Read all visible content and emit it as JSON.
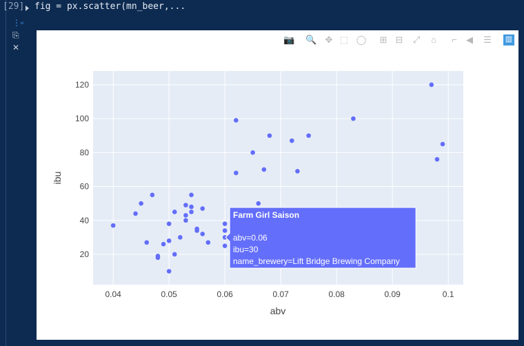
{
  "cell": {
    "execution_count": "[29]",
    "code": "fig = px.scatter(mn_beer,..."
  },
  "toolbar": [
    {
      "name": "camera-icon",
      "glyph": "📷"
    },
    {
      "name": "zoom-icon",
      "glyph": "🔍"
    },
    {
      "name": "pan-icon",
      "glyph": "✥"
    },
    {
      "name": "box-select-icon",
      "glyph": "⬚"
    },
    {
      "name": "lasso-icon",
      "glyph": "◯"
    },
    {
      "name": "zoom-in-icon",
      "glyph": "⊞"
    },
    {
      "name": "zoom-out-icon",
      "glyph": "⊟"
    },
    {
      "name": "autoscale-icon",
      "glyph": "⤢"
    },
    {
      "name": "reset-axes-icon",
      "glyph": "⌂"
    },
    {
      "name": "spike-lines-icon",
      "glyph": "⌐"
    },
    {
      "name": "hover-closest-icon",
      "glyph": "◀"
    },
    {
      "name": "hover-compare-icon",
      "glyph": "☰"
    },
    {
      "name": "plotly-logo-icon",
      "glyph": "▥"
    }
  ],
  "colors": {
    "marker": "#636efa",
    "plot_bg": "#e5ecf6",
    "grid": "#ffffff"
  },
  "chart_data": {
    "type": "scatter",
    "xlabel": "abv",
    "ylabel": "ibu",
    "xlim": [
      0.0364,
      0.1027
    ],
    "ylim": [
      2.1,
      128.1
    ],
    "xticks": [
      0.04,
      0.05,
      0.06,
      0.07,
      0.08,
      0.09,
      0.1
    ],
    "xtick_labels": [
      "0.04",
      "0.05",
      "0.06",
      "0.07",
      "0.08",
      "0.09",
      "0.1"
    ],
    "yticks": [
      20,
      40,
      60,
      80,
      100,
      120
    ],
    "ytick_labels": [
      "20",
      "40",
      "60",
      "80",
      "100",
      "120"
    ],
    "points": [
      [
        0.04,
        37
      ],
      [
        0.044,
        44
      ],
      [
        0.045,
        50
      ],
      [
        0.047,
        55
      ],
      [
        0.046,
        27
      ],
      [
        0.048,
        19
      ],
      [
        0.048,
        18
      ],
      [
        0.049,
        26
      ],
      [
        0.05,
        38
      ],
      [
        0.05,
        10
      ],
      [
        0.05,
        28
      ],
      [
        0.051,
        45
      ],
      [
        0.051,
        20
      ],
      [
        0.052,
        30
      ],
      [
        0.053,
        49
      ],
      [
        0.053,
        43
      ],
      [
        0.053,
        40
      ],
      [
        0.054,
        55
      ],
      [
        0.054,
        48
      ],
      [
        0.054,
        45
      ],
      [
        0.055,
        35
      ],
      [
        0.055,
        34
      ],
      [
        0.056,
        47
      ],
      [
        0.056,
        32
      ],
      [
        0.057,
        27
      ],
      [
        0.06,
        38
      ],
      [
        0.06,
        34
      ],
      [
        0.06,
        30
      ],
      [
        0.06,
        25
      ],
      [
        0.062,
        99
      ],
      [
        0.062,
        68
      ],
      [
        0.065,
        80
      ],
      [
        0.066,
        50
      ],
      [
        0.067,
        70
      ],
      [
        0.068,
        90
      ],
      [
        0.072,
        87
      ],
      [
        0.073,
        69
      ],
      [
        0.075,
        90
      ],
      [
        0.083,
        100
      ],
      [
        0.097,
        120
      ],
      [
        0.098,
        76
      ],
      [
        0.099,
        85
      ]
    ],
    "hover": {
      "x": 0.06,
      "y": 30,
      "title": "Farm Girl Saison",
      "line1": "abv=0.06",
      "line2": "ibu=30",
      "line3": "name_brewery=Lift Bridge Brewing Company"
    }
  }
}
